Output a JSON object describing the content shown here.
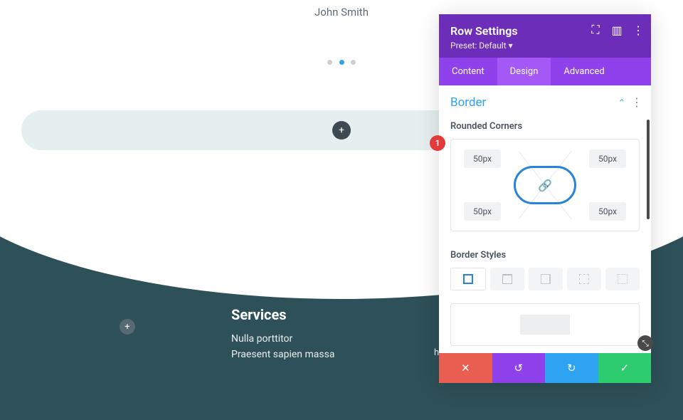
{
  "page": {
    "author": "John Smith",
    "services_heading": "Services",
    "services_line1": "Nulla porttitor",
    "services_line2": "Praesent sapien massa",
    "footer_email": "hello@divitherapy.com"
  },
  "panel": {
    "title": "Row Settings",
    "preset": "Preset: Default ▾",
    "tabs": {
      "content": "Content",
      "design": "Design",
      "advanced": "Advanced"
    },
    "section_border": "Border",
    "rounded_label": "Rounded Corners",
    "corners": {
      "tl": "50px",
      "tr": "50px",
      "bl": "50px",
      "br": "50px"
    },
    "styles_label": "Border Styles"
  },
  "badge": {
    "num": "1"
  },
  "icons": {
    "plus": "+",
    "chev_up": "⌃",
    "vdots": "⋮",
    "link": "🔗",
    "x": "✕",
    "undo": "↺",
    "redo": "↻",
    "check": "✓",
    "expand": "⛶",
    "columns": "▥",
    "resize": "⤡"
  }
}
